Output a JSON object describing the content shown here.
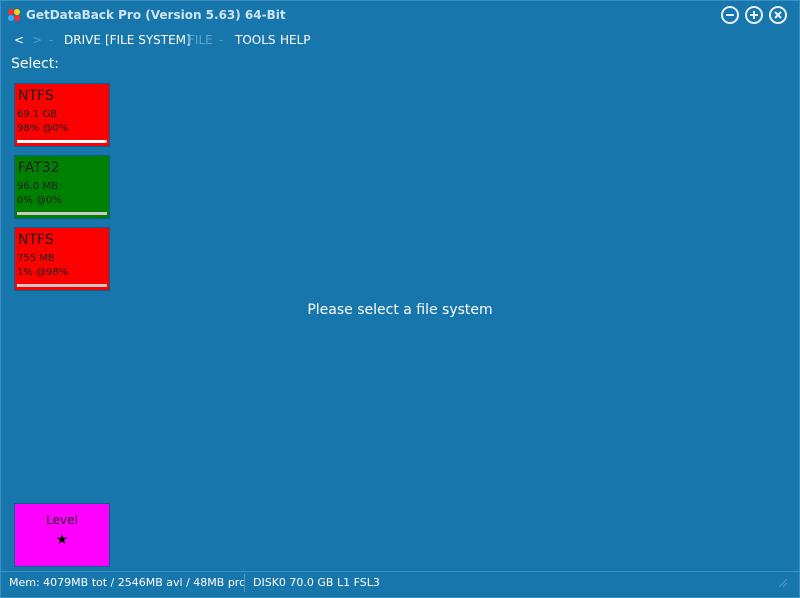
{
  "window": {
    "title": "GetDataBack Pro (Version 5.63) 64-Bit",
    "minimize_icon": "minus-icon",
    "maximize_icon": "plus-icon",
    "close_icon": "close-icon"
  },
  "menu": {
    "back": "<",
    "forward": ">",
    "sep1": "-",
    "drive": "DRIVE",
    "file_system": "[FILE SYSTEM]",
    "file": "FILE",
    "sep2": "-",
    "tools": "TOOLS",
    "help": "HELP"
  },
  "select_label": "Select:",
  "file_systems": [
    {
      "type": "NTFS",
      "size": "69.1 GB",
      "quality": "98% @0%",
      "bar_fraction": 0.98,
      "color": "#ff0000"
    },
    {
      "type": "FAT32",
      "size": "96.0 MB",
      "quality": "0% @0%",
      "bar_fraction": 0.0,
      "color": "#008000"
    },
    {
      "type": "NTFS",
      "size": "755 MB",
      "quality": "1% @98%",
      "bar_fraction": 0.01,
      "color": "#ff0000"
    }
  ],
  "center_message": "Please select a file system",
  "level": {
    "label": "Level",
    "stars": "★"
  },
  "status": {
    "memory": "Mem: 4079MB tot / 2546MB avl / 48MB prc",
    "disk": "DISK0 70.0 GB L1 FSL3"
  },
  "colors": {
    "background": "#1776ac",
    "level_box": "#ff00ff"
  }
}
